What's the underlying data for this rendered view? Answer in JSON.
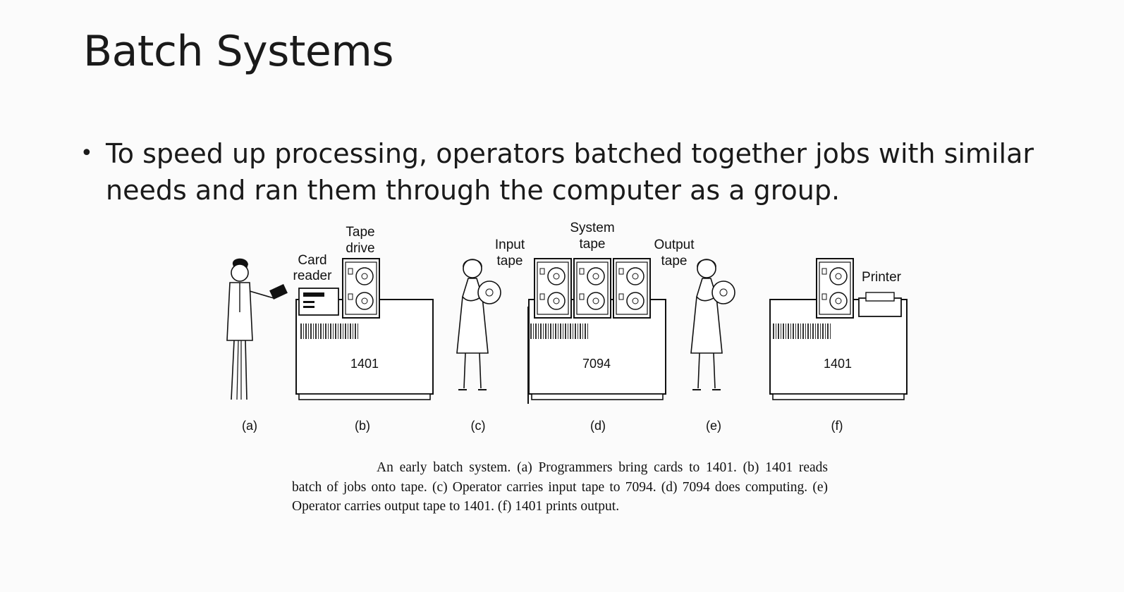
{
  "slide": {
    "title": "Batch Systems",
    "bullet": "To speed up processing, operators batched together jobs with similar needs and ran them through the computer as a group."
  },
  "figure": {
    "labels": {
      "card_reader_1": "Card",
      "card_reader_2": "reader",
      "tape_drive_1": "Tape",
      "tape_drive_2": "drive",
      "input_tape_1": "Input",
      "input_tape_2": "tape",
      "system_tape_1": "System",
      "system_tape_2": "tape",
      "output_tape_1": "Output",
      "output_tape_2": "tape",
      "printer": "Printer"
    },
    "machines": {
      "left": "1401",
      "middle": "7094",
      "right": "1401"
    },
    "panel_letters": [
      "(a)",
      "(b)",
      "(c)",
      "(d)",
      "(e)",
      "(f)"
    ],
    "caption": "An early batch system. (a) Programmers bring cards to 1401. (b) 1401 reads batch of jobs onto tape. (c) Operator carries input tape to 7094. (d) 7094 does computing. (e) Operator carries output tape to 1401. (f) 1401 prints output."
  }
}
